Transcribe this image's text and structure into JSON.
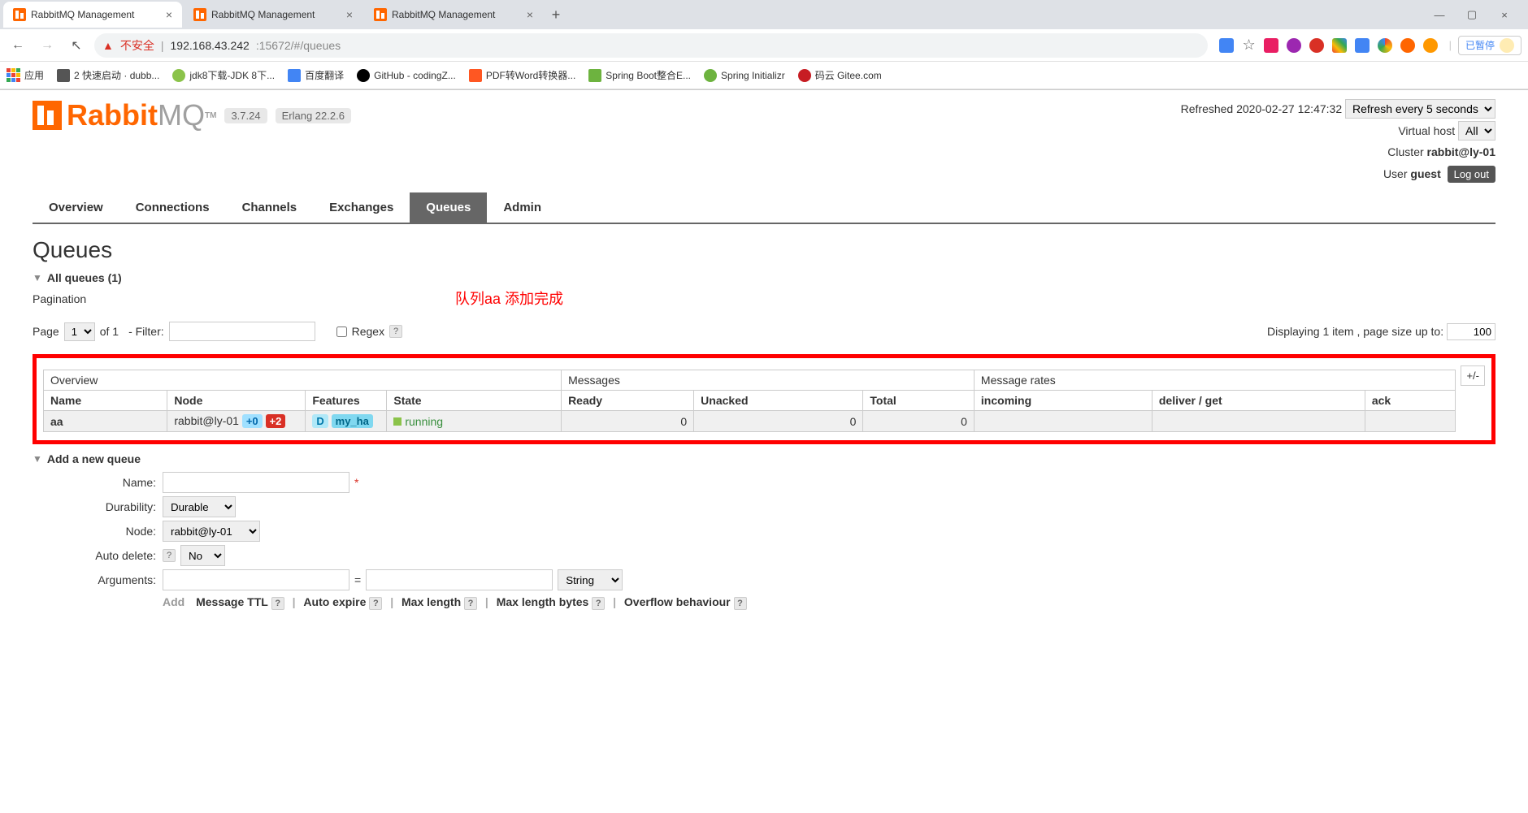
{
  "browser": {
    "tabs": [
      {
        "title": "RabbitMQ Management",
        "active": true
      },
      {
        "title": "RabbitMQ Management",
        "active": false
      },
      {
        "title": "RabbitMQ Management",
        "active": false
      }
    ],
    "url_insecure": "不安全",
    "url_host": "192.168.43.242",
    "url_rest": ":15672/#/queues",
    "paused": "已暂停",
    "bookmarks": {
      "apps": "应用",
      "b1": "2 快速启动 · dubb...",
      "b2": "jdk8下载-JDK 8下...",
      "b3": "百度翻译",
      "b4": "GitHub - codingZ...",
      "b5": "PDF转Word转换器...",
      "b6": "Spring Boot整合E...",
      "b7": "Spring Initializr",
      "b8": "码云 Gitee.com"
    }
  },
  "header": {
    "version": "3.7.24",
    "erlang": "Erlang 22.2.6",
    "refreshed": "Refreshed 2020-02-27 12:47:32",
    "refresh_select": "Refresh every 5 seconds",
    "vhost_label": "Virtual host",
    "vhost": "All",
    "cluster_label": "Cluster",
    "cluster": "rabbit@ly-01",
    "user_label": "User",
    "user": "guest",
    "logout": "Log out"
  },
  "nav": {
    "overview": "Overview",
    "connections": "Connections",
    "channels": "Channels",
    "exchanges": "Exchanges",
    "queues": "Queues",
    "admin": "Admin"
  },
  "page": {
    "title": "Queues",
    "all_queues": "All queues (1)",
    "pagination": "Pagination",
    "page_label": "Page",
    "page_val": "1",
    "of_label": "of 1",
    "filter_label": "- Filter:",
    "regex": "Regex",
    "displaying": "Displaying 1 item , page size up to:",
    "page_size": "100",
    "annotation": "队列aa 添加完成",
    "plus_minus": "+/-"
  },
  "table": {
    "hdr_overview": "Overview",
    "hdr_messages": "Messages",
    "hdr_rates": "Message rates",
    "hdr_name": "Name",
    "hdr_node": "Node",
    "hdr_features": "Features",
    "hdr_state": "State",
    "hdr_ready": "Ready",
    "hdr_unacked": "Unacked",
    "hdr_total": "Total",
    "hdr_incoming": "incoming",
    "hdr_deliver": "deliver / get",
    "hdr_ack": "ack",
    "row": {
      "name": "aa",
      "node": "rabbit@ly-01",
      "badge1": "+0",
      "badge2": "+2",
      "feat_d": "D",
      "feat_ha": "my_ha",
      "state": "running",
      "ready": "0",
      "unacked": "0",
      "total": "0"
    }
  },
  "add": {
    "title": "Add a new queue",
    "name": "Name:",
    "durability": "Durability:",
    "durability_val": "Durable",
    "node": "Node:",
    "node_val": "rabbit@ly-01",
    "auto_delete": "Auto delete:",
    "auto_delete_val": "No",
    "arguments": "Arguments:",
    "arg_type": "String",
    "add_word": "Add",
    "h1": "Message TTL",
    "h2": "Auto expire",
    "h3": "Max length",
    "h4": "Max length bytes",
    "h5": "Overflow behaviour"
  }
}
